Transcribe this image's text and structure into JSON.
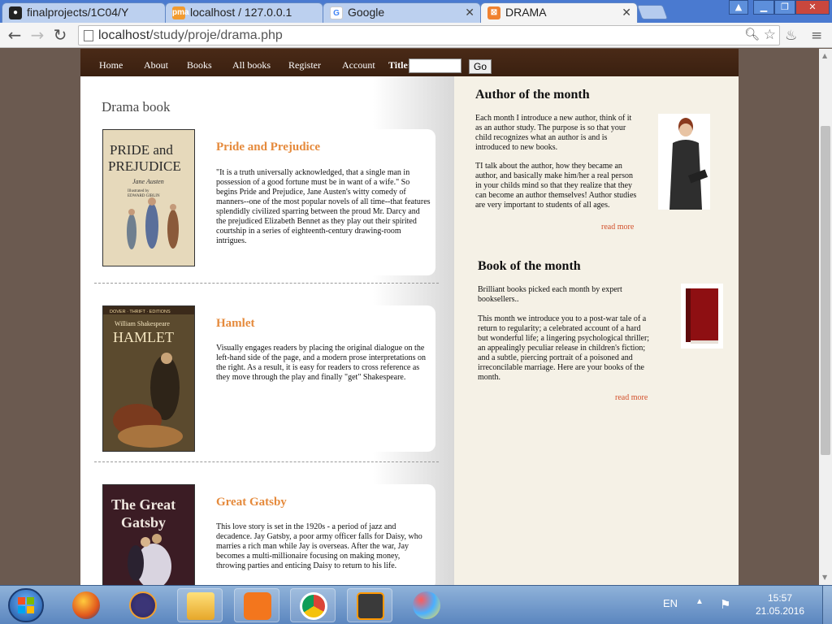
{
  "browser": {
    "tabs": [
      {
        "label": "finalprojects/1C04/Y",
        "favicon": "github-icon"
      },
      {
        "label": "localhost / 127.0.0.1",
        "favicon": "phpmyadmin-icon"
      },
      {
        "label": "Google",
        "favicon": "google-icon"
      },
      {
        "label": "DRAMA",
        "favicon": "xampp-icon"
      }
    ],
    "url_host": "localhost",
    "url_path": "/study/proje/drama.php"
  },
  "nav": {
    "items": [
      "Home",
      "About",
      "Books",
      "All books",
      "Register",
      "Account"
    ],
    "title_label": "Title:",
    "go_label": "Go"
  },
  "main": {
    "section_title": "Drama book",
    "books": [
      {
        "title": "Pride and Prejudice",
        "description": "\"It is a truth universally acknowledged, that a single man in possession of a good fortune must be in want of a wife.\" So begins Pride and Prejudice, Jane Austen's witty comedy of manners--one of the most popular novels of all time--that features splendidly civilized sparring between the proud Mr. Darcy and the prejudiced Elizabeth Bennet as they play out their spirited courtship in a series of eighteenth-century drawing-room intrigues.",
        "cover_text": [
          "PRIDE and",
          "PREJUDICE",
          "Jane Austen",
          "Illustrated by",
          "EDWARD GIBLIN"
        ]
      },
      {
        "title": "Hamlet",
        "description": "Visually engages readers by placing the original dialogue on the left-hand side of the page, and a modern prose interpretations on the right. As a result, it is easy for readers to cross reference as they move through the play and finally \"get\" Shakespeare.",
        "cover_text": [
          "DOVER · THRIFT · EDITIONS",
          "William Shakespeare",
          "HAMLET"
        ]
      },
      {
        "title": "Great Gatsby",
        "description": "This love story is set in the 1920s - a period of jazz and decadence. Jay Gatsby, a poor army officer falls for Daisy, who marries a rich man while Jay is overseas. After the war, Jay becomes a multi-millionaire focusing on making money, throwing parties and enticing Daisy to return to his life.",
        "cover_text": [
          "The Great",
          "Gatsby"
        ]
      }
    ]
  },
  "sidebar": {
    "author": {
      "heading": "Author of the month",
      "para1": "Each month I introduce a new author, think of it as an author study. The purpose is so that your child recognizes what an author is and is introduced to new books.",
      "para2": "TI talk about the author, how they became an author, and basically make him/her a real person in your childs mind so that they realize that they can become an author themselves! Author studies are very important to students of all ages.",
      "read_more": "read more"
    },
    "book": {
      "heading": "Book of the month",
      "para1": "Brilliant books picked each month by expert booksellers..",
      "para2": "This month we introduce you to a post-war tale of a return to regularity; a celebrated account of a hard but wonderful life; a lingering psychological thriller; an appealingly peculiar release in children's fiction; and a subtle, piercing portrait of a poisoned and irreconcilable marriage. Here are your books of the month.",
      "read_more": "read more"
    }
  },
  "taskbar": {
    "apps": [
      "firefox-icon",
      "eclipse-icon",
      "explorer-icon",
      "xampp-icon",
      "chrome-icon",
      "sublime-icon",
      "paint-icon"
    ],
    "language": "EN",
    "time": "15:57",
    "date": "21.05.2016"
  }
}
